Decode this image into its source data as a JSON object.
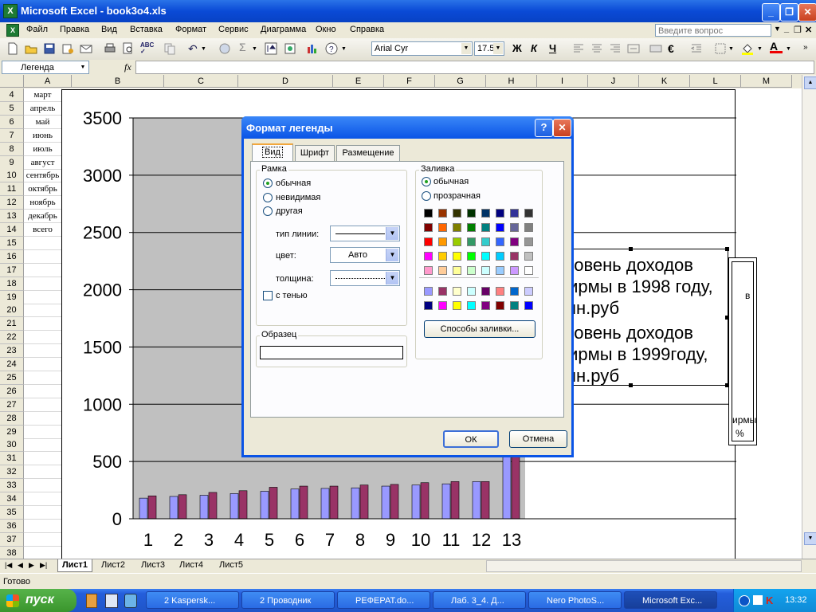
{
  "window": {
    "title": "Microsoft Excel - book3o4.xls"
  },
  "menu": [
    "Файл",
    "Правка",
    "Вид",
    "Вставка",
    "Формат",
    "Сервис",
    "Диаграмма",
    "Окно",
    "Справка"
  ],
  "help_placeholder": "Введите вопрос",
  "toolbar": {
    "font": "Arial Cyr",
    "size": "17.5",
    "bold": "Ж",
    "italic": "К",
    "underline": "Ч"
  },
  "formula": {
    "name_box": "Легенда",
    "fx": "fx"
  },
  "columns": [
    "A",
    "B",
    "C",
    "D",
    "E",
    "F",
    "G",
    "H",
    "I",
    "J",
    "K",
    "L",
    "M"
  ],
  "rows": [
    "4",
    "5",
    "6",
    "7",
    "8",
    "9",
    "10",
    "11",
    "12",
    "13",
    "14",
    "15",
    "16",
    "17",
    "18",
    "19",
    "20",
    "21",
    "22",
    "23",
    "24",
    "25",
    "26",
    "27",
    "28",
    "29",
    "30",
    "31",
    "32",
    "33",
    "34",
    "35",
    "36",
    "37",
    "38"
  ],
  "col_a": [
    "март",
    "апрель",
    "май",
    "июнь",
    "июль",
    "август",
    "сентябрь",
    "октябрь",
    "ноябрь",
    "декабрь",
    "всего"
  ],
  "chart_data": {
    "type": "bar",
    "categories": [
      "1",
      "2",
      "3",
      "4",
      "5",
      "6",
      "7",
      "8",
      "9",
      "10",
      "11",
      "12",
      "13"
    ],
    "series": [
      {
        "name": "Уровень доходов фирмы в 1998 году, млн.руб",
        "values": [
          180,
          195,
          205,
          220,
          240,
          260,
          265,
          270,
          285,
          295,
          305,
          325,
          3300
        ]
      },
      {
        "name": "Уровень доходов фирмы в 1999году, млн.руб",
        "values": [
          200,
          210,
          230,
          245,
          275,
          285,
          285,
          295,
          300,
          315,
          325,
          325,
          3330
        ]
      }
    ],
    "yticks": [
      "0",
      "500",
      "1000",
      "1500",
      "2000",
      "2500",
      "3000",
      "3500"
    ],
    "ylim": [
      0,
      3500
    ],
    "colors": [
      "#9999ff",
      "#993366"
    ],
    "plot_bg": "#c0c0c0",
    "grid": true
  },
  "legend": {
    "lines1": [
      "Уровень доходов",
      "фирмы в 1998 году,",
      "млн.руб"
    ],
    "lines2": [
      "Уровень доходов",
      "фирмы в 1999году,",
      "млн.руб"
    ]
  },
  "side_box": {
    "text_top": "в",
    "text_mid": "ирмы",
    "text_bot": "%"
  },
  "dialog": {
    "title": "Формат легенды",
    "tabs": [
      "Вид",
      "Шрифт",
      "Размещение"
    ],
    "frame_group": "Рамка",
    "frame_options": [
      "обычная",
      "невидимая",
      "другая"
    ],
    "line_type_label": "тип линии:",
    "color_label": "цвет:",
    "color_value": "Авто",
    "thickness_label": "толщина:",
    "shadow_label": "с тенью",
    "sample_group": "Образец",
    "fill_group": "Заливка",
    "fill_options": [
      "обычная",
      "прозрачная"
    ],
    "fill_effects": "Способы заливки...",
    "ok": "ОК",
    "cancel": "Отмена",
    "palette": [
      [
        "#000000",
        "#993300",
        "#333300",
        "#003300",
        "#003366",
        "#000080",
        "#333399",
        "#333333"
      ],
      [
        "#800000",
        "#ff6600",
        "#808000",
        "#008000",
        "#008080",
        "#0000ff",
        "#666699",
        "#808080"
      ],
      [
        "#ff0000",
        "#ff9900",
        "#99cc00",
        "#339966",
        "#33cccc",
        "#3366ff",
        "#800080",
        "#969696"
      ],
      [
        "#ff00ff",
        "#ffcc00",
        "#ffff00",
        "#00ff00",
        "#00ffff",
        "#00ccff",
        "#993366",
        "#c0c0c0"
      ],
      [
        "#ff99cc",
        "#ffcc99",
        "#ffff99",
        "#ccffcc",
        "#ccffff",
        "#99ccff",
        "#cc99ff",
        "#ffffff"
      ]
    ],
    "palette2": [
      [
        "#9999ff",
        "#993366",
        "#ffffcc",
        "#ccffff",
        "#660066",
        "#ff8080",
        "#0066cc",
        "#ccccff"
      ],
      [
        "#000080",
        "#ff00ff",
        "#ffff00",
        "#00ffff",
        "#800080",
        "#800000",
        "#008080",
        "#0000ff"
      ]
    ]
  },
  "sheets": [
    "Лист1",
    "Лист2",
    "Лист3",
    "Лист4",
    "Лист5"
  ],
  "status": "Готово",
  "taskbar": {
    "start": "пуск",
    "tasks": [
      "2 Kaspersk...",
      "2 Проводник",
      "РЕФЕРАТ.do...",
      "Лаб. 3_4. Д...",
      "Nero PhotoS...",
      "Microsoft Exc..."
    ],
    "clock": "13:32"
  }
}
